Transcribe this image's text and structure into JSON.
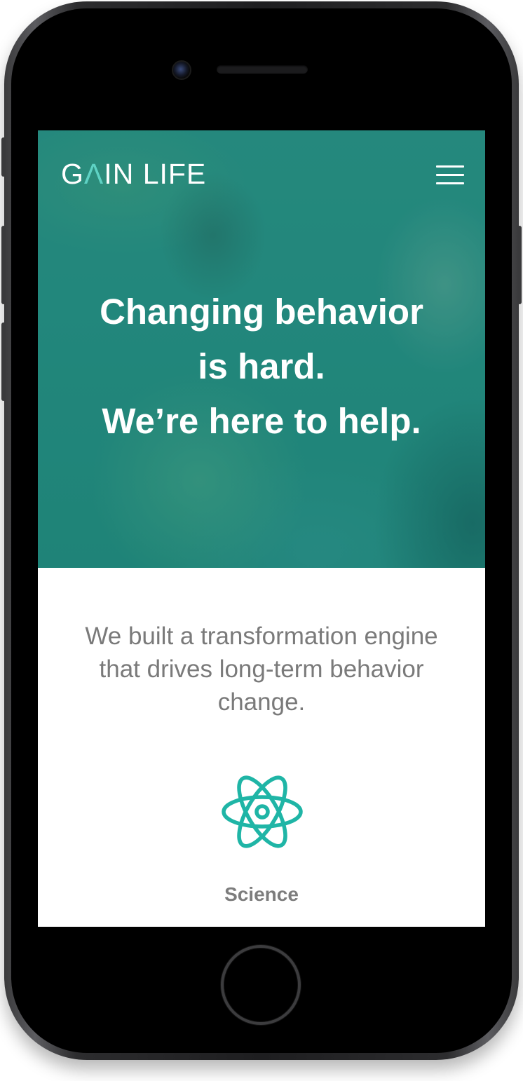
{
  "header": {
    "logo_part1": "G",
    "logo_accent": "Λ",
    "logo_part2": "IN LIFE",
    "menu_icon": "hamburger-menu-icon"
  },
  "hero": {
    "line1": "Changing behavior",
    "line2": "is hard.",
    "line3": "We’re here to help."
  },
  "intro": {
    "text": "We built a transformation engine that drives long-term behavior change."
  },
  "feature": {
    "icon": "atom-icon",
    "label": "Science"
  },
  "colors": {
    "brand_teal": "#2a8a7e",
    "accent": "#1fb5a6",
    "text_gray": "#7a7a7a"
  }
}
